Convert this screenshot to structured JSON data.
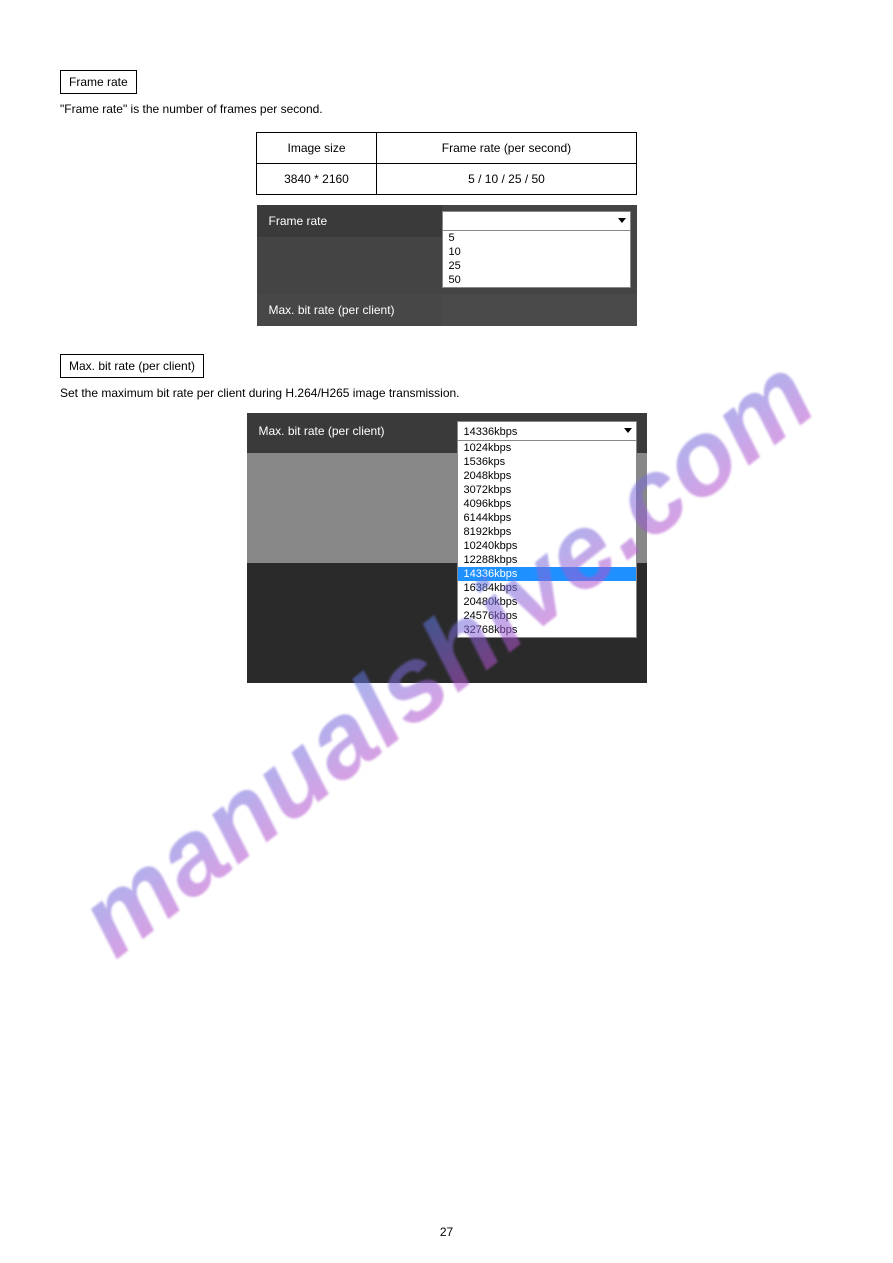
{
  "section1": {
    "label": "Frame rate",
    "text": "\"Frame rate\" is the number of frames per second.",
    "table": {
      "row1_k": "Image size",
      "row1_v": "Frame rate (per second)",
      "row2_k": "3840 * 2160",
      "row2_v": "5 / 10 / 25 / 50"
    },
    "widget": {
      "row1_label": "Frame rate",
      "row2_label": "Max. bit rate (per client)",
      "options": [
        "5",
        "10",
        "25",
        "50"
      ]
    }
  },
  "section2": {
    "label": "Max. bit rate (per client)",
    "text": "Set the maximum bit rate per client during H.264/H265 image transmission.",
    "widget": {
      "label": "Max. bit rate (per client)",
      "selected": "14336kbps",
      "options": [
        "1024kbps",
        "1536kps",
        "2048kbps",
        "3072kbps",
        "4096kbps",
        "6144kbps",
        "8192kbps",
        "10240kbps",
        "12288kbps",
        "14336kbps",
        "16384kbps",
        "20480kbps",
        "24576kbps",
        "32768kbps"
      ],
      "highlight_index": 9
    }
  },
  "watermark": "manualshive.com",
  "page_number": "27"
}
